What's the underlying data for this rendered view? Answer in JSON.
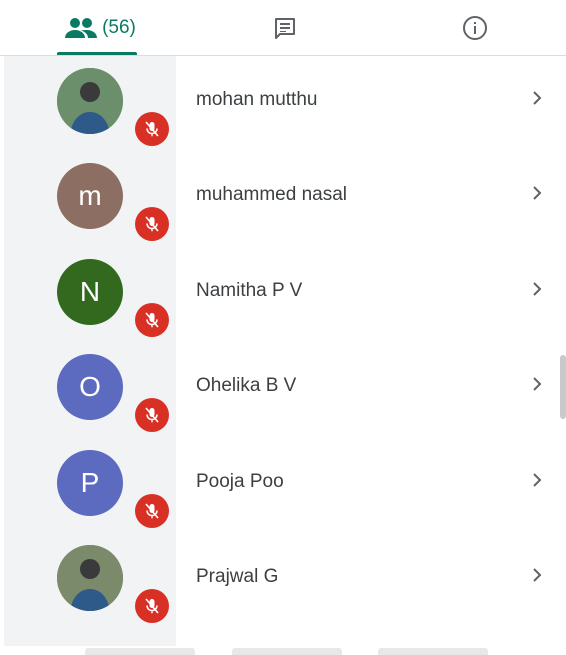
{
  "tabs": {
    "people_count": "(56)",
    "active": "people",
    "chat_icon": "chat-icon",
    "info_icon": "info-icon"
  },
  "participants": [
    {
      "name": "mohan mutthu",
      "initial": "",
      "avatar_color": "#6b8f6b",
      "muted": true
    },
    {
      "name": "muhammed nasal",
      "initial": "m",
      "avatar_color": "#8d6e63",
      "muted": true
    },
    {
      "name": "Namitha P V",
      "initial": "N",
      "avatar_color": "#33691e",
      "muted": true
    },
    {
      "name": "Ohelika B V",
      "initial": "O",
      "avatar_color": "#5c6bc0",
      "muted": true
    },
    {
      "name": "Pooja Poo",
      "initial": "P",
      "avatar_color": "#5c6bc0",
      "muted": true
    },
    {
      "name": "Prajwal G",
      "initial": "",
      "avatar_color": "#7a8a6a",
      "muted": true
    }
  ],
  "colors": {
    "accent": "#0b7a62",
    "mute": "#d93025"
  }
}
